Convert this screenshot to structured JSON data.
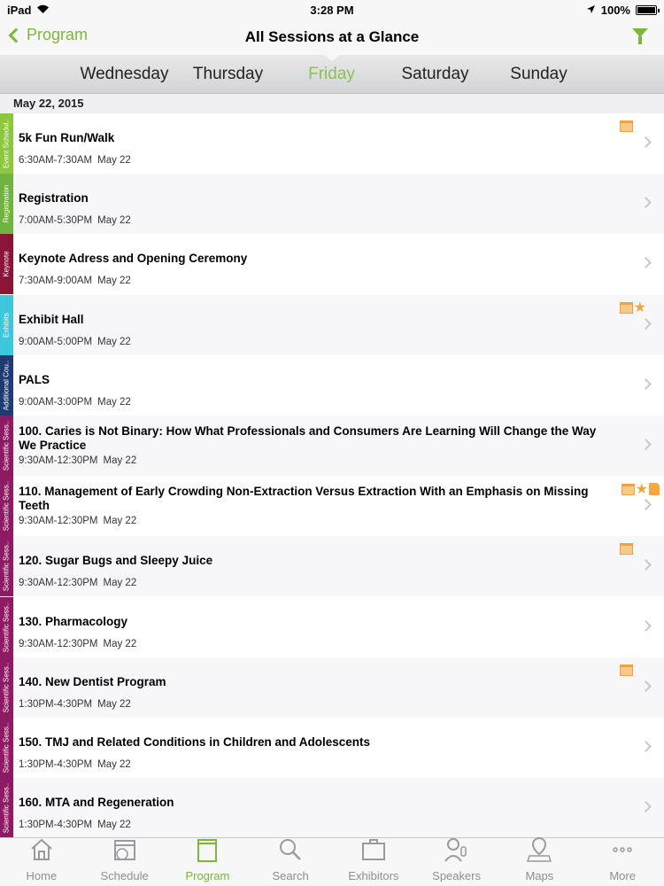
{
  "status": {
    "device": "iPad",
    "time": "3:28 PM",
    "battery": "100%"
  },
  "nav": {
    "back_label": "Program",
    "title": "All Sessions at a Glance"
  },
  "days": [
    {
      "label": "Wednesday",
      "active": false
    },
    {
      "label": "Thursday",
      "active": false
    },
    {
      "label": "Friday",
      "active": true
    },
    {
      "label": "Saturday",
      "active": false
    },
    {
      "label": "Sunday",
      "active": false
    }
  ],
  "accent_color": "#7bb83a",
  "date_header": "May 22, 2015",
  "sessions": [
    {
      "category": "Event Schedul..",
      "cat_color": "#8dc63f",
      "title": "5k Fun Run/Walk",
      "time": "6:30AM-7:30AM",
      "date": "May 22",
      "icons": [
        "calendar-icon"
      ]
    },
    {
      "category": "Registration",
      "cat_color": "#6fb43f",
      "title": "Registration",
      "time": "7:00AM-5:30PM",
      "date": "May 22",
      "icons": []
    },
    {
      "category": "Keynote",
      "cat_color": "#8a1538",
      "title": "Keynote Adress and Opening Ceremony",
      "time": "7:30AM-9:00AM",
      "date": "May 22",
      "icons": []
    },
    {
      "category": "Exhibits",
      "cat_color": "#3ec6dd",
      "title": "Exhibit Hall",
      "time": "9:00AM-5:00PM",
      "date": "May 22",
      "icons": [
        "calendar-icon",
        "star-icon"
      ]
    },
    {
      "category": "Additional Cou..",
      "cat_color": "#1f3b73",
      "title": "PALS",
      "time": "9:00AM-3:00PM",
      "date": "May 22",
      "icons": []
    },
    {
      "category": "Scientific Sess..",
      "cat_color": "#8e1a64",
      "title": "100. Caries is Not Binary: How What Professionals and Consumers Are Learning Will Change the Way We Practice",
      "time": "9:30AM-12:30PM",
      "date": "May 22",
      "icons": []
    },
    {
      "category": "Scientific Sess..",
      "cat_color": "#8e1a64",
      "title": "110. Management of Early Crowding Non-Extraction Versus Extraction With an Emphasis on Missing Teeth",
      "time": "9:30AM-12:30PM",
      "date": "May 22",
      "icons": [
        "calendar-icon",
        "star-icon",
        "note-icon"
      ]
    },
    {
      "category": "Scientific Sess..",
      "cat_color": "#8e1a64",
      "title": "120. Sugar Bugs and Sleepy Juice",
      "time": "9:30AM-12:30PM",
      "date": "May 22",
      "icons": [
        "calendar-icon"
      ]
    },
    {
      "category": "Scientific Sess..",
      "cat_color": "#8e1a64",
      "title": "130. Pharmacology",
      "time": "9:30AM-12:30PM",
      "date": "May 22",
      "icons": []
    },
    {
      "category": "Scientific Sess..",
      "cat_color": "#8e1a64",
      "title": "140. New Dentist Program",
      "time": "1:30PM-4:30PM",
      "date": "May 22",
      "icons": [
        "calendar-icon"
      ]
    },
    {
      "category": "Scientific Sess..",
      "cat_color": "#8e1a64",
      "title": "150. TMJ and Related Conditions in Children and Adolescents",
      "time": "1:30PM-4:30PM",
      "date": "May 22",
      "icons": []
    },
    {
      "category": "Scientific Sess..",
      "cat_color": "#8e1a64",
      "title": "160. MTA and Regeneration",
      "time": "1:30PM-4:30PM",
      "date": "May 22",
      "icons": []
    }
  ],
  "tabs": [
    {
      "label": "Home",
      "icon": "home-icon",
      "active": false
    },
    {
      "label": "Schedule",
      "icon": "calendar-icon",
      "active": false
    },
    {
      "label": "Program",
      "icon": "book-icon",
      "active": true
    },
    {
      "label": "Search",
      "icon": "search-icon",
      "active": false
    },
    {
      "label": "Exhibitors",
      "icon": "briefcase-icon",
      "active": false
    },
    {
      "label": "Speakers",
      "icon": "microphone-icon",
      "active": false
    },
    {
      "label": "Maps",
      "icon": "map-icon",
      "active": false
    },
    {
      "label": "More",
      "icon": "more-icon",
      "active": false
    }
  ]
}
